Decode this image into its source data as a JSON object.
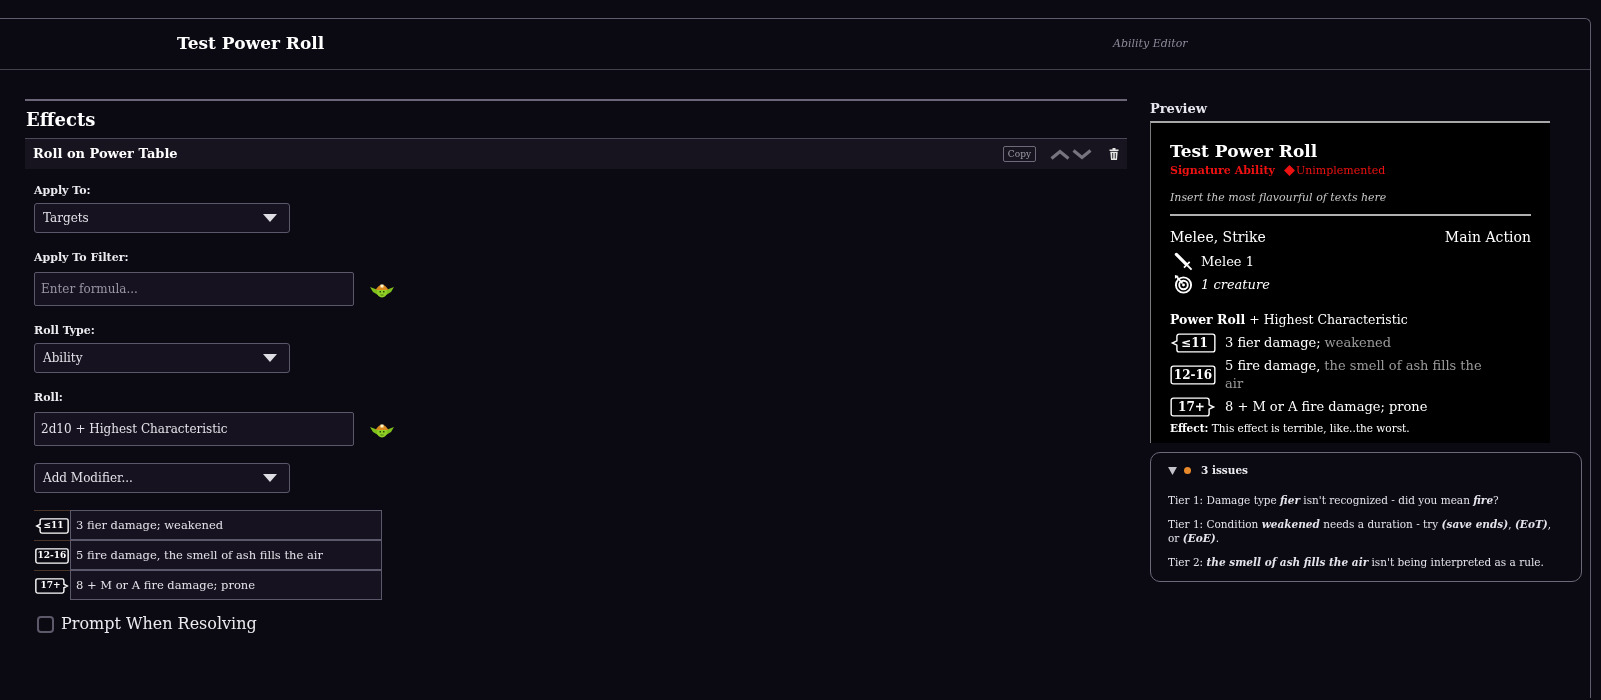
{
  "window": {
    "title": "Test Power Roll",
    "subtitle": "Ability Editor"
  },
  "effects": {
    "heading": "Effects",
    "effect": {
      "title": "Roll on Power Table",
      "copy_label": "Copy",
      "fields": [
        {
          "kind": "select",
          "label": "Apply To:",
          "value": "Targets"
        },
        {
          "kind": "formula",
          "label": "Apply To Filter:",
          "placeholder": "Enter formula..."
        },
        {
          "kind": "select",
          "label": "Roll Type:",
          "value": "Ability"
        },
        {
          "kind": "formula",
          "label": "Roll:",
          "value": "2d10 + Highest Characteristic"
        },
        {
          "kind": "select",
          "value": "Add Modifier..."
        }
      ],
      "tiers": [
        {
          "kind": "low",
          "badge": "≤11",
          "value": "3 fier damage; weakened"
        },
        {
          "kind": "mid",
          "badge": "12-16",
          "value": "5 fire damage, the smell of ash fills the air"
        },
        {
          "kind": "high",
          "badge": "17+",
          "value": "8 + M or A fire damage; prone"
        }
      ],
      "prompt": {
        "label": "Prompt When Resolving",
        "checked": false
      }
    }
  },
  "preview": {
    "heading": "Preview",
    "card": {
      "title": "Test Power Roll",
      "tag": "Signature Ability",
      "status": "Unimplemented",
      "flavour": "Insert the most flavourful of texts here",
      "keywords": "Melee, Strike",
      "action": "Main Action",
      "distance": "Melee 1",
      "target": "1 creature",
      "power_roll": "**Power Roll** + Highest Characteristic",
      "tiers": [
        {
          "kind": "low",
          "badge": "≤11",
          "text": "3 fier damage;",
          "note": "weakened"
        },
        {
          "kind": "mid",
          "badge": "12-16",
          "text": "5 fire damage,",
          "note": "the smell of ash fills the air"
        },
        {
          "kind": "high",
          "badge": "17+",
          "text": "8 + M or A fire damage; prone"
        }
      ],
      "effect": "**Effect:** This effect is terrible, like..the worst."
    }
  },
  "issues": {
    "summary": "3 issues",
    "expanded": true,
    "items": [
      "Tier 1: Damage type **fier** isn't recognized - did you mean **fire**?",
      "Tier 1: Condition **weakened** needs a duration - try **(save ends)**, **(EoT)**, or **(EoE)**.",
      "Tier 2: **the smell of ash fills the air** isn't being interpreted as a rule."
    ]
  }
}
